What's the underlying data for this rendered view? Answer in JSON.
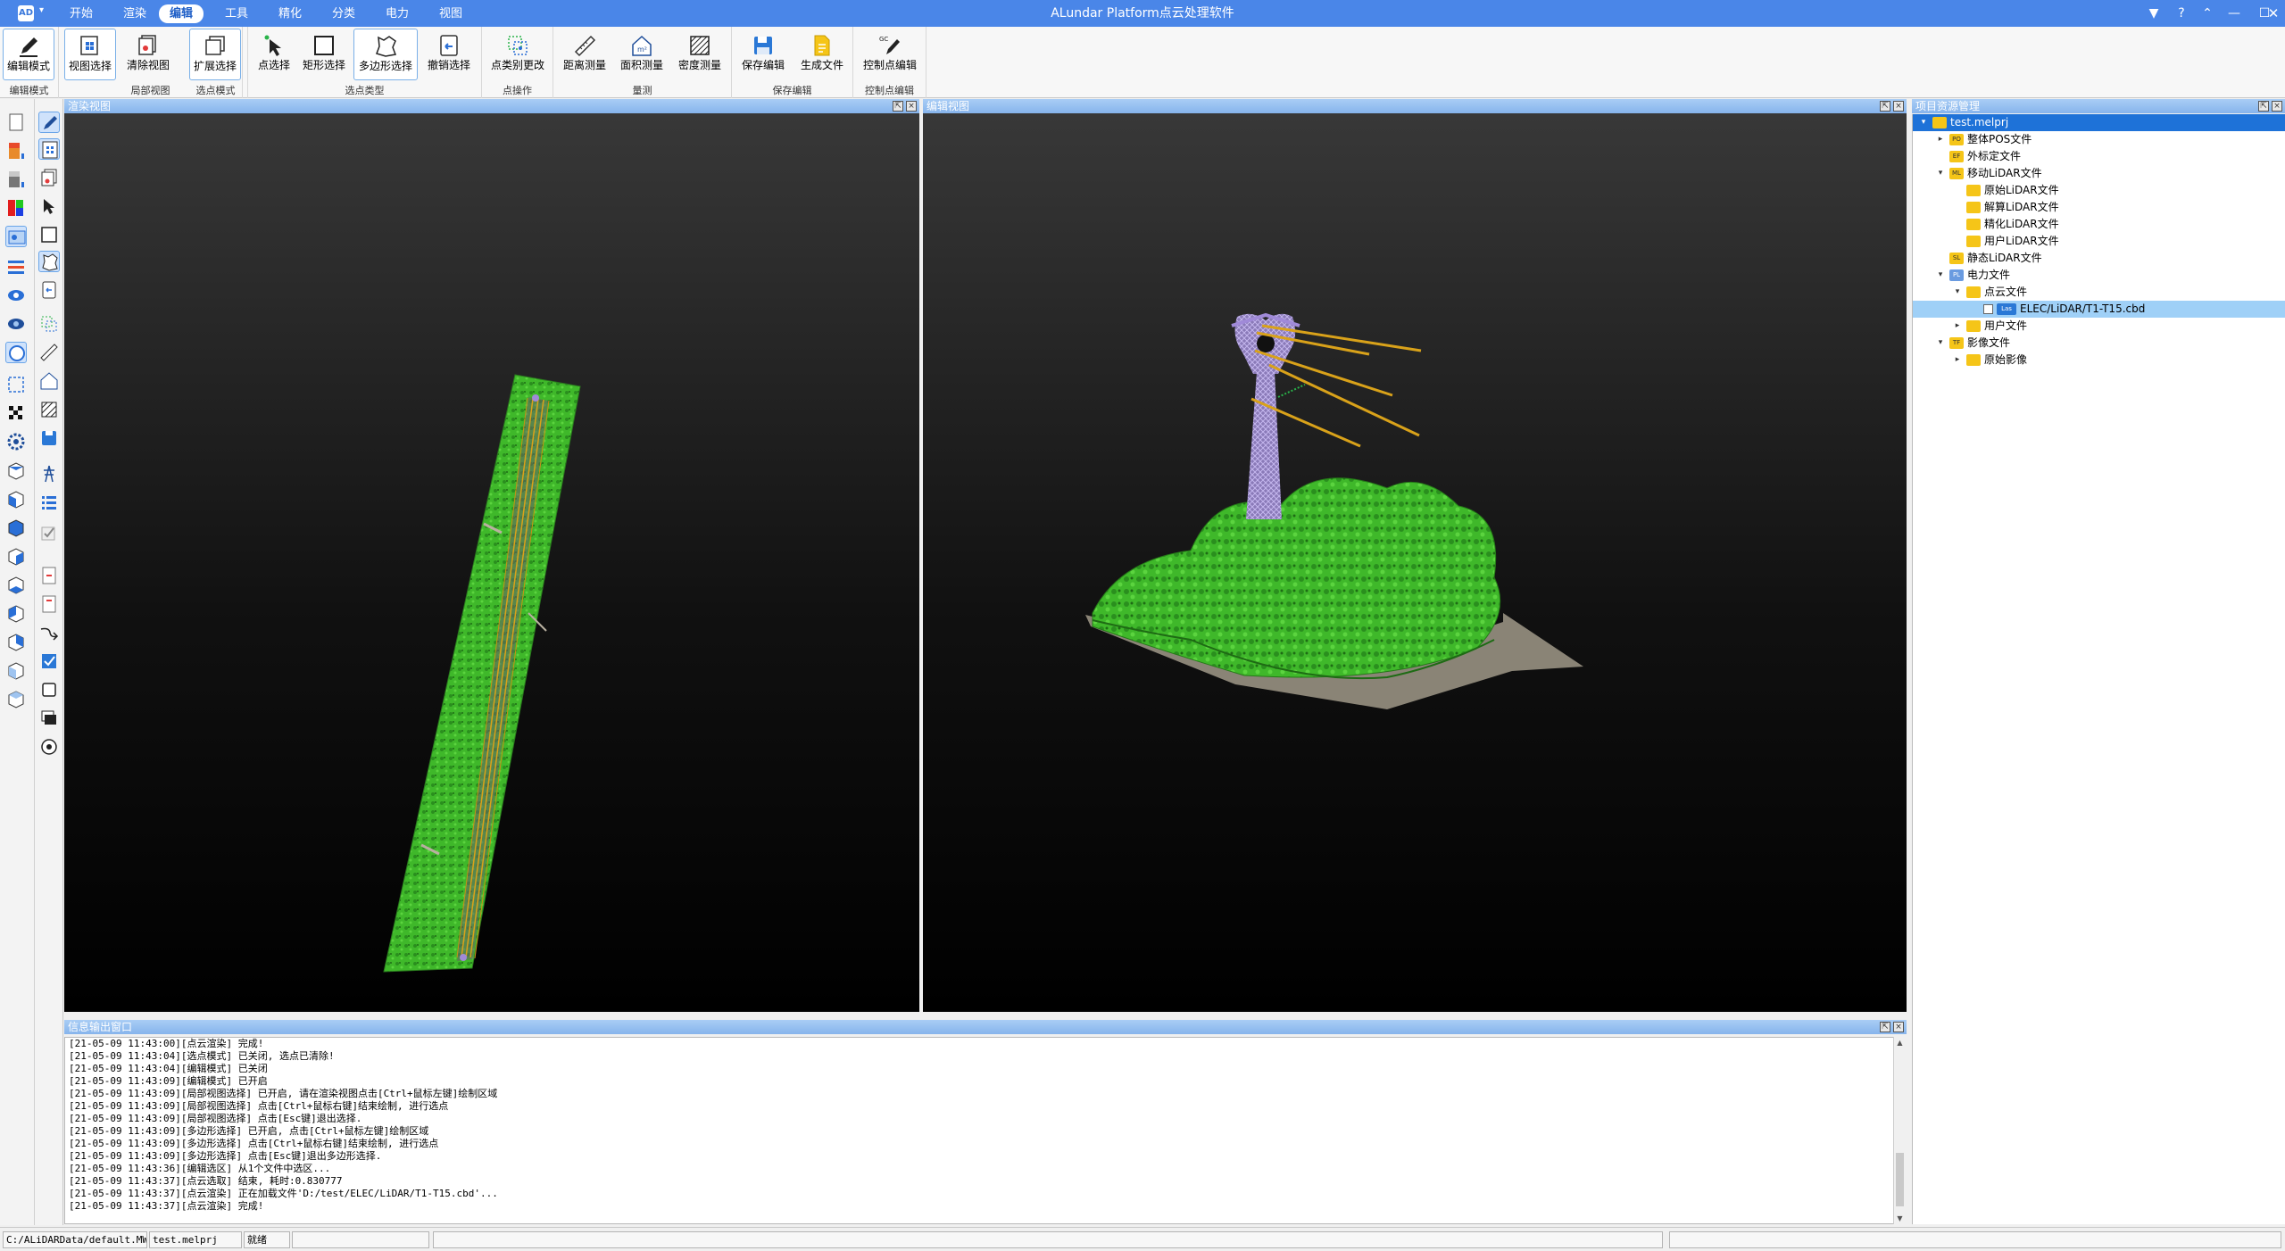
{
  "app": {
    "title": "ALundar Platform点云处理软件",
    "badge": "AD",
    "badge_arrow": "▾"
  },
  "menu": [
    "开始",
    "渲染",
    "编辑",
    "工具",
    "精化",
    "分类",
    "电力",
    "视图"
  ],
  "ribbon": {
    "groups": {
      "edit_mode": "编辑模式",
      "local_view": "局部视图",
      "select_mode": "选点模式",
      "select_type": "选点类型",
      "point_ops": "点操作",
      "measure": "量测",
      "save_edit": "保存编辑",
      "control_edit": "控制点编辑"
    },
    "buttons": {
      "edit_mode": "编辑模式",
      "view_select": "视图选择",
      "clear_view": "清除视图",
      "expand_select": "扩展选择",
      "point_select": "点选择",
      "rect_select": "矩形选择",
      "polygon_select": "多边形选择",
      "cancel_select": "撤销选择",
      "class_change": "点类别更改",
      "distance": "距离测量",
      "area": "面积测量",
      "density": "密度测量",
      "save": "保存编辑",
      "generate": "生成文件",
      "control_point": "控制点编辑"
    }
  },
  "panels": {
    "render_view": "渲染视图",
    "edit_view": "编辑视图",
    "log": "信息输出窗口",
    "project": "项目资源管理"
  },
  "log_lines": [
    "[21-05-09 11:43:00][点云渲染] 完成!",
    "[21-05-09 11:43:04][选点模式] 已关闭,  选点已清除!",
    "[21-05-09 11:43:04][编辑模式] 已关闭",
    "[21-05-09 11:43:09][编辑模式] 已开启",
    "[21-05-09 11:43:09][局部视图选择] 已开启,  请在渲染视图点击[Ctrl+鼠标左键]绘制区域",
    "[21-05-09 11:43:09][局部视图选择] 点击[Ctrl+鼠标右键]结束绘制, 进行选点",
    "[21-05-09 11:43:09][局部视图选择] 点击[Esc键]退出选择.",
    "[21-05-09 11:43:09][多边形选择] 已开启,  点击[Ctrl+鼠标左键]绘制区域",
    "[21-05-09 11:43:09][多边形选择] 点击[Ctrl+鼠标右键]结束绘制, 进行选点",
    "[21-05-09 11:43:09][多边形选择] 点击[Esc键]退出多边形选择.",
    "[21-05-09 11:43:36][编辑选区] 从1个文件中选区...",
    "[21-05-09 11:43:37][点云选取] 结束, 耗时:0.830777",
    "[21-05-09 11:43:37][点云渲染] 正在加载文件'D:/test/ELEC/LiDAR/T1-T15.cbd'...",
    "[21-05-09 11:43:37][点云渲染] 完成!"
  ],
  "tree": [
    {
      "label": "test.melprj",
      "level": 0,
      "expander": "▾",
      "icon": "project-folder",
      "selected": true
    },
    {
      "label": "整体POS文件",
      "level": 1,
      "expander": "▸",
      "icon": "pos-file",
      "badge": "PO"
    },
    {
      "label": "外标定文件",
      "level": 1,
      "expander": "",
      "icon": "ef-file",
      "badge": "EF"
    },
    {
      "label": "移动LiDAR文件",
      "level": 1,
      "expander": "▾",
      "icon": "ml-file",
      "badge": "ML"
    },
    {
      "label": "原始LiDAR文件",
      "level": 2,
      "expander": "",
      "icon": "folder"
    },
    {
      "label": "解算LiDAR文件",
      "level": 2,
      "expander": "",
      "icon": "folder"
    },
    {
      "label": "精化LiDAR文件",
      "level": 2,
      "expander": "",
      "icon": "folder"
    },
    {
      "label": "用户LiDAR文件",
      "level": 2,
      "expander": "",
      "icon": "folder"
    },
    {
      "label": "静态LiDAR文件",
      "level": 1,
      "expander": "",
      "icon": "sl-file",
      "badge": "SL"
    },
    {
      "label": "电力文件",
      "level": 1,
      "expander": "▾",
      "icon": "power-file",
      "badge": "PL"
    },
    {
      "label": "点云文件",
      "level": 2,
      "expander": "▾",
      "icon": "folder"
    },
    {
      "label": "ELEC/LiDAR/T1-T15.cbd",
      "level": 3,
      "expander": "",
      "icon": "las-file",
      "badge": "Las",
      "checked": true,
      "highlight": true
    },
    {
      "label": "用户文件",
      "level": 2,
      "expander": "▸",
      "icon": "folder"
    },
    {
      "label": "影像文件",
      "level": 1,
      "expander": "▾",
      "icon": "image-file",
      "badge": "TF"
    },
    {
      "label": "原始影像",
      "level": 2,
      "expander": "▸",
      "icon": "folder"
    }
  ],
  "status": {
    "path": "C:/ALiDARData/default.MWS",
    "project": "test.melprj",
    "state": "就绪"
  },
  "colors": {
    "titlebar": "#4a86e8",
    "accent": "#1e72d8",
    "vegetation": "#3fb82a",
    "powerline": "#d9a21a",
    "tower": "#a08ad8"
  }
}
